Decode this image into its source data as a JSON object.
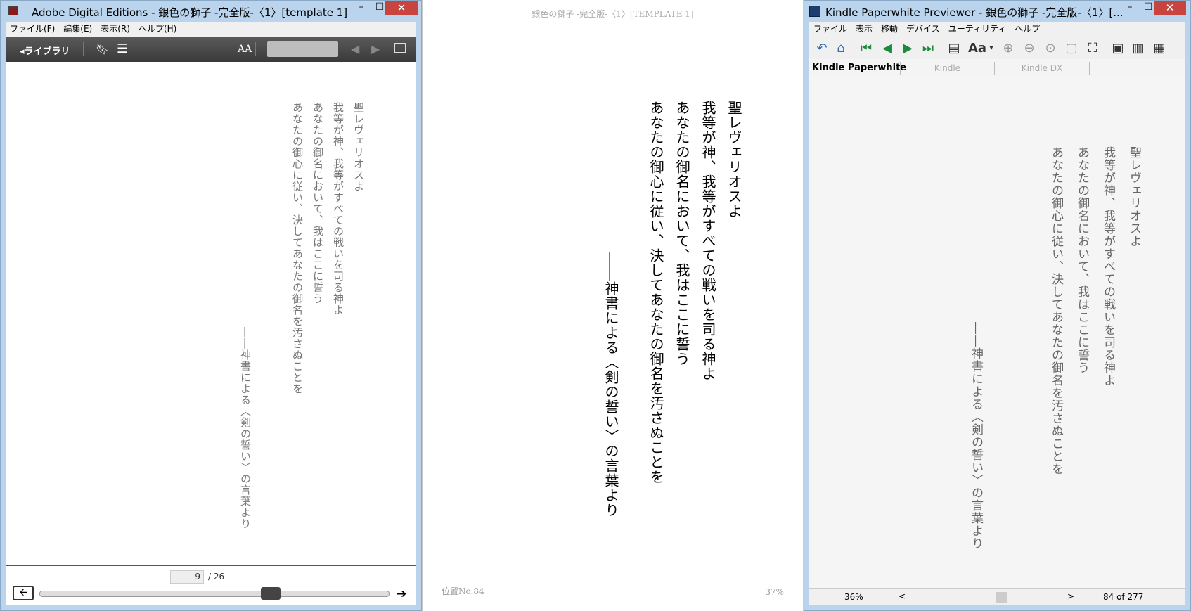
{
  "ade": {
    "title": "Adobe Digital Editions - 銀色の獅子 -完全版-〈1〉[template 1]",
    "minimize": "–",
    "maximize": "☐",
    "close": "✕",
    "menu": [
      "ファイル(F)",
      "編集(E)",
      "表示(R)",
      "ヘルプ(H)"
    ],
    "library_label": "◂ライブラリ",
    "font_label": "AA",
    "page_current": "9",
    "page_total": "/ 26",
    "text_lines": [
      "聖レヴェリオスよ",
      "我等が神、我等がすべての戦いを司る神よ",
      "あなたの御名において、我はここに誓う",
      "あなたの御心に従い、決してあなたの御名を汚さぬことを"
    ],
    "attribution": "――神書による〈剣の誓い〉の言葉より"
  },
  "middle": {
    "header": "銀色の獅子 -完全版-〈1〉[TEMPLATE 1]",
    "text_lines": [
      "聖レヴェリオスよ",
      "我等が神、我等がすべての戦いを司る神よ",
      "あなたの御名において、我はここに誓う",
      "あなたの御心に従い、決してあなたの御名を汚さぬことを"
    ],
    "attribution": "――神書による〈剣の誓い〉の言葉より",
    "location": "位置No.84",
    "percent": "37%"
  },
  "kpp": {
    "title": "Kindle Paperwhite Previewer - 銀色の獅子 -完全版-〈1〉[...",
    "minimize": "–",
    "maximize": "☐",
    "close": "✕",
    "menu": [
      "ファイル",
      "表示",
      "移動",
      "デバイス",
      "ユーティリティ",
      "ヘルプ"
    ],
    "font_label": "Aa",
    "tabs": [
      "Kindle Paperwhite",
      "Kindle",
      "Kindle DX"
    ],
    "text_lines": [
      "聖レヴェリオスよ",
      "我等が神、我等がすべての戦いを司る神よ",
      "あなたの御名において、我はここに誓う",
      "あなたの御心に従い、決してあなたの御名を汚さぬことを"
    ],
    "attribution": "――神書による〈剣の誓い〉の言葉より",
    "status_percent": "36%",
    "status_prev": "<",
    "status_next": ">",
    "status_pages": "84 of 277"
  },
  "colors": {
    "window_frame": "#b9d4ec",
    "close_button": "#c7453e",
    "ade_toolbar": "#4a4a4a"
  },
  "progress": {
    "ade_slider_fraction": 0.67
  }
}
